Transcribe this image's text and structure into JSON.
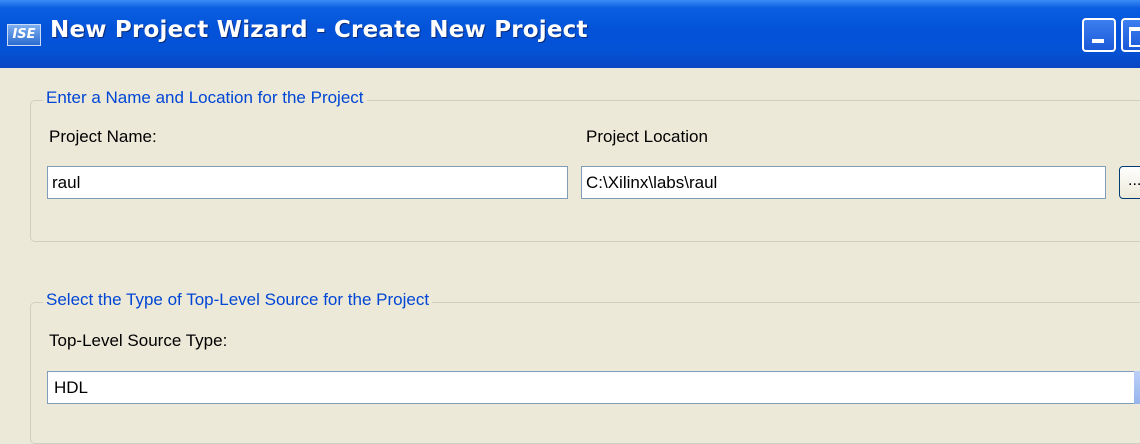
{
  "window": {
    "title": "New Project Wizard - Create New Project",
    "icon": "ise-app-icon",
    "icon_text": "ISE"
  },
  "name_location_group": {
    "legend": "Enter a Name and Location for the Project",
    "project_name_label": "Project Name:",
    "project_name_value": "raul",
    "project_location_label": "Project Location",
    "project_location_value": "C:\\Xilinx\\labs\\raul",
    "browse_label": "..."
  },
  "source_type_group": {
    "legend": "Select the Type of Top-Level Source for the Project",
    "source_type_label": "Top-Level Source Type:",
    "source_type_value": "HDL"
  },
  "colors": {
    "titlebar": "#0352d8",
    "background": "#ece9d8",
    "legend_text": "#0046d5"
  }
}
